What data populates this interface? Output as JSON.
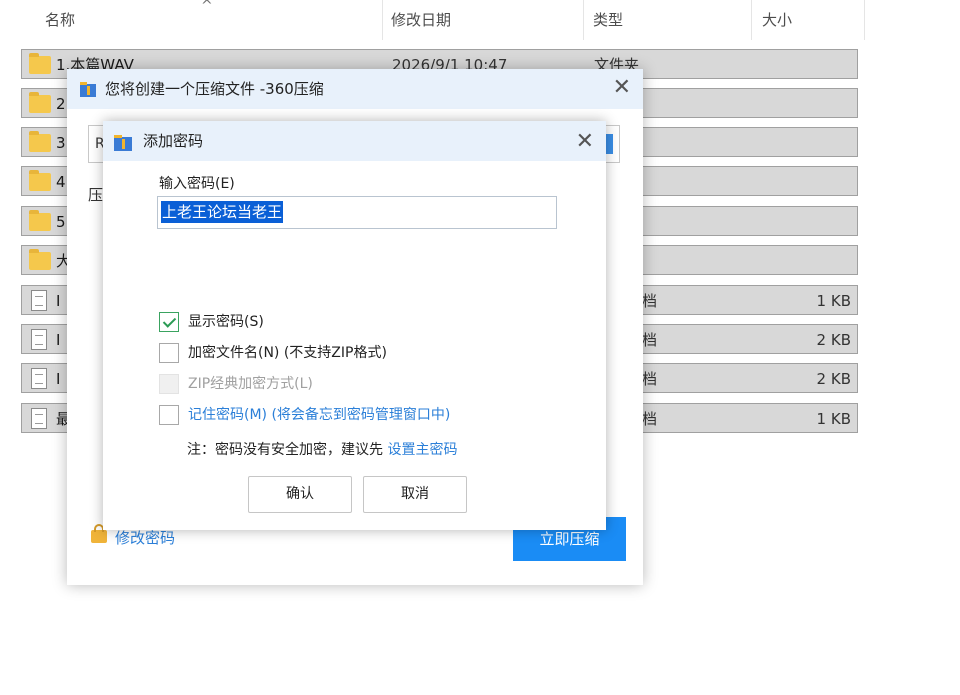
{
  "explorer": {
    "columns": {
      "name": "名称",
      "modified": "修改日期",
      "type": "类型",
      "size": "大小"
    },
    "rows": [
      {
        "name": "1.本篇WAV",
        "date": "2026/9/1 10:47",
        "type": "文件夹",
        "size": "",
        "icon": "folder-icon"
      },
      {
        "name": "2",
        "date": "",
        "type": "",
        "size": "",
        "icon": "folder-icon"
      },
      {
        "name": "3",
        "date": "",
        "type": "",
        "size": "",
        "icon": "folder-icon"
      },
      {
        "name": "4",
        "date": "",
        "type": "",
        "size": "",
        "icon": "folder-icon"
      },
      {
        "name": "5",
        "date": "",
        "type": "",
        "size": "",
        "icon": "folder-icon"
      },
      {
        "name": "大",
        "date": "",
        "type": "",
        "size": "",
        "icon": "folder-icon"
      },
      {
        "name": "I",
        "date": "",
        "type": "档",
        "size": "1 KB",
        "icon": "document-icon"
      },
      {
        "name": "I",
        "date": "",
        "type": "档",
        "size": "2 KB",
        "icon": "document-icon"
      },
      {
        "name": "I",
        "date": "",
        "type": "档",
        "size": "2 KB",
        "icon": "document-icon"
      },
      {
        "name": "最",
        "date": "",
        "type": "档",
        "size": "1 KB",
        "icon": "document-icon"
      }
    ]
  },
  "compress_window": {
    "title": "您将创建一个压缩文件 -360压缩",
    "field_value": "R",
    "label": "压",
    "modify_password": "修改密码",
    "compress_now": "立即压缩"
  },
  "password_dialog": {
    "title": "添加密码",
    "input_label": "输入密码(E)",
    "password_value": "上老王论坛当老王",
    "options": [
      {
        "label": "显示密码(S)",
        "checked": true,
        "disabled": false,
        "link": false
      },
      {
        "label": "加密文件名(N) (不支持ZIP格式)",
        "checked": false,
        "disabled": false,
        "link": false
      },
      {
        "label": "ZIP经典加密方式(L)",
        "checked": false,
        "disabled": true,
        "link": false
      },
      {
        "label": "记住密码(M) (将会备忘到密码管理窗口中)",
        "checked": false,
        "disabled": false,
        "link": true
      }
    ],
    "note_prefix": "注：密码没有安全加密，建议先",
    "note_link": "设置主密码",
    "ok": "确认",
    "cancel": "取消"
  },
  "colors": {
    "accent": "#1a8cf5",
    "link": "#2b7fd8",
    "title_bar": "#e8f1fb",
    "row_bg": "#d8d8d8",
    "selection": "#0a5fd6"
  }
}
